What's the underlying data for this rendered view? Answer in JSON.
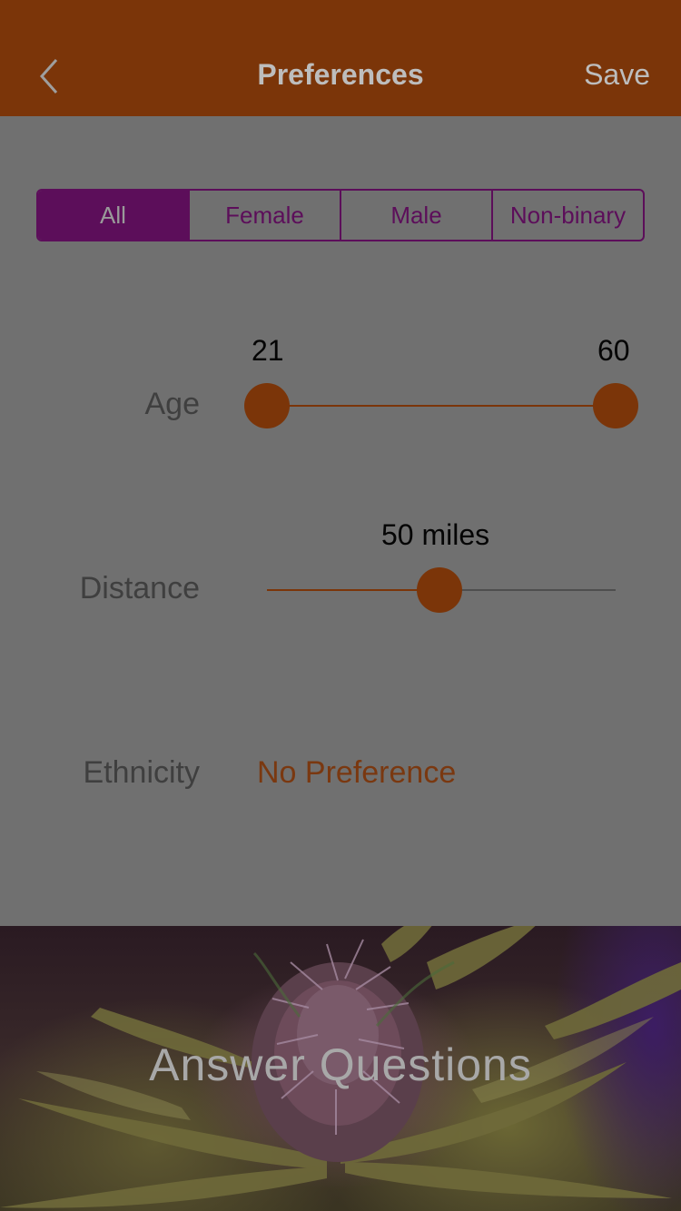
{
  "nav": {
    "title": "Preferences",
    "save_label": "Save",
    "back_icon": "chevron-left-icon"
  },
  "gender_filter": {
    "options": [
      "All",
      "Female",
      "Male",
      "Non-binary"
    ],
    "selected": "All"
  },
  "age": {
    "label": "Age",
    "min_value": "21",
    "max_value": "60"
  },
  "distance": {
    "label": "Distance",
    "value_text": "50 miles",
    "fraction": 0.5
  },
  "ethnicity": {
    "label": "Ethnicity",
    "value": "No Preference"
  },
  "banner": {
    "label": "Answer Questions"
  },
  "colors": {
    "accent": "#7b3509",
    "segment": "#5c0e5a"
  }
}
